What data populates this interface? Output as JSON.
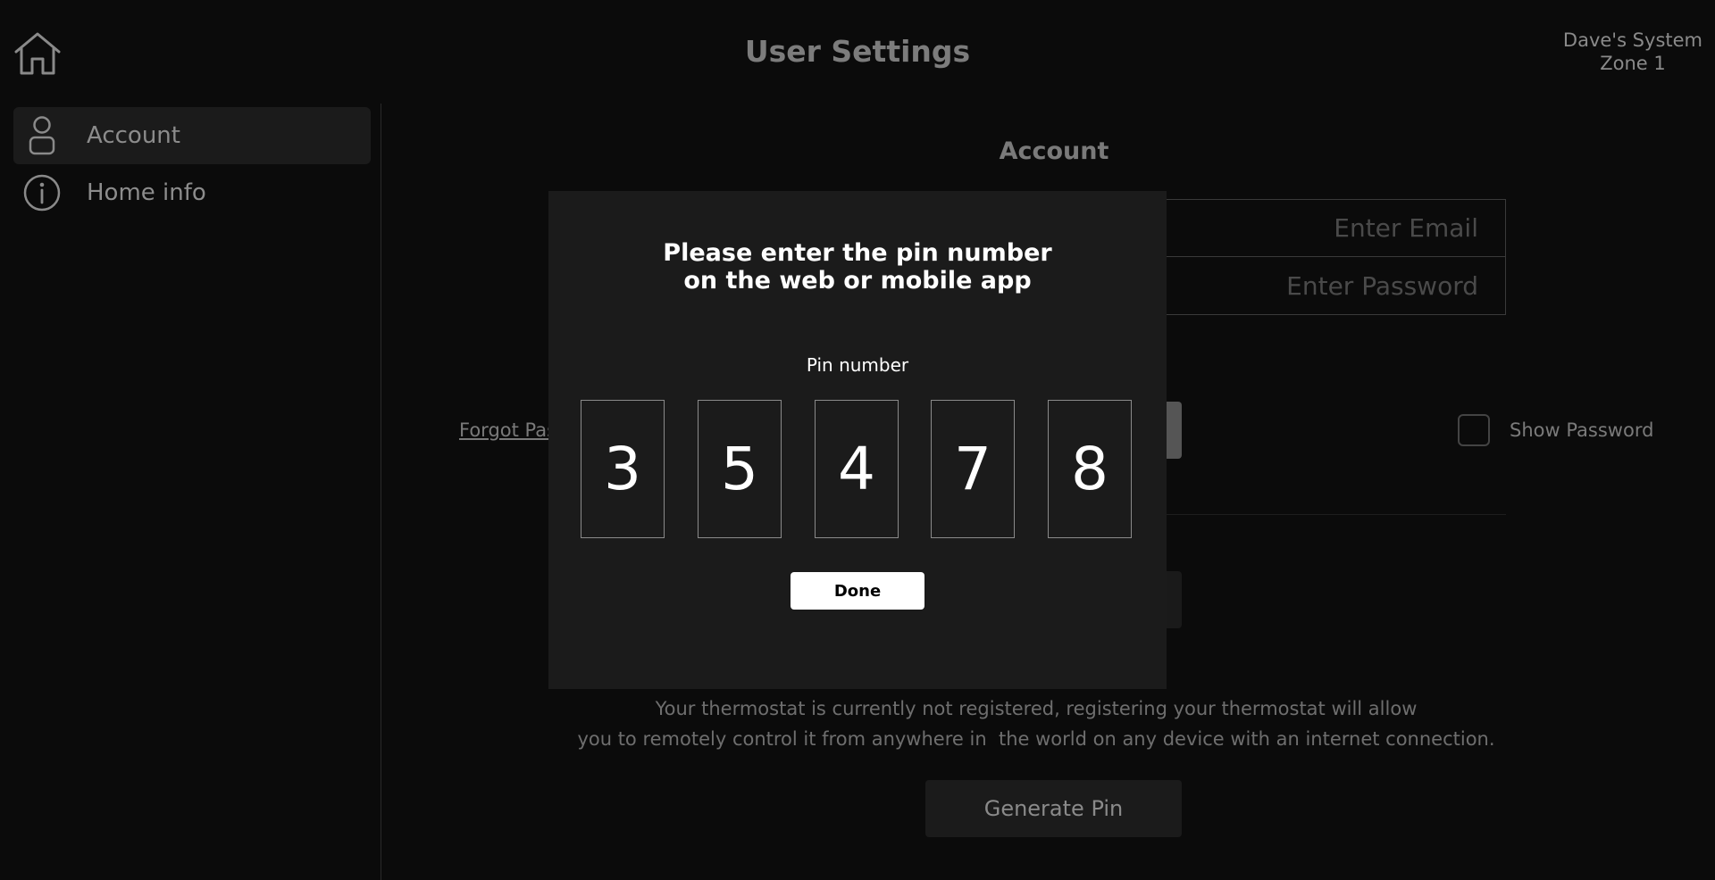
{
  "header": {
    "title": "User Settings",
    "system_name": "Dave's System",
    "zone": "Zone 1"
  },
  "sidebar": {
    "items": [
      {
        "label": "Account",
        "icon": "person-icon",
        "active": true
      },
      {
        "label": "Home info",
        "icon": "info-icon",
        "active": false
      }
    ]
  },
  "account": {
    "title": "Account",
    "email_placeholder": "Enter Email",
    "email_value": "",
    "password_placeholder": "Enter Password",
    "password_value": "",
    "forgot_password": "Forgot Pas",
    "show_password_label": "Show Password",
    "show_password_checked": false,
    "registration_text_line1": "Your thermostat is currently not registered, registering your thermostat will allow",
    "registration_text_line2": "you to remotely control it from anywhere in  the world on any device with an internet connection.",
    "generate_pin_label": "Generate Pin"
  },
  "modal": {
    "title_line1": "Please enter the pin number",
    "title_line2": "on the web or mobile app",
    "pin_label": "Pin number",
    "pin_digits": [
      "3",
      "5",
      "4",
      "7",
      "8"
    ],
    "done_label": "Done"
  },
  "colors": {
    "background": "#0b0b0b",
    "modal_background": "#1b1b1b",
    "muted_text": "#7a7a7a",
    "white": "#ffffff"
  }
}
